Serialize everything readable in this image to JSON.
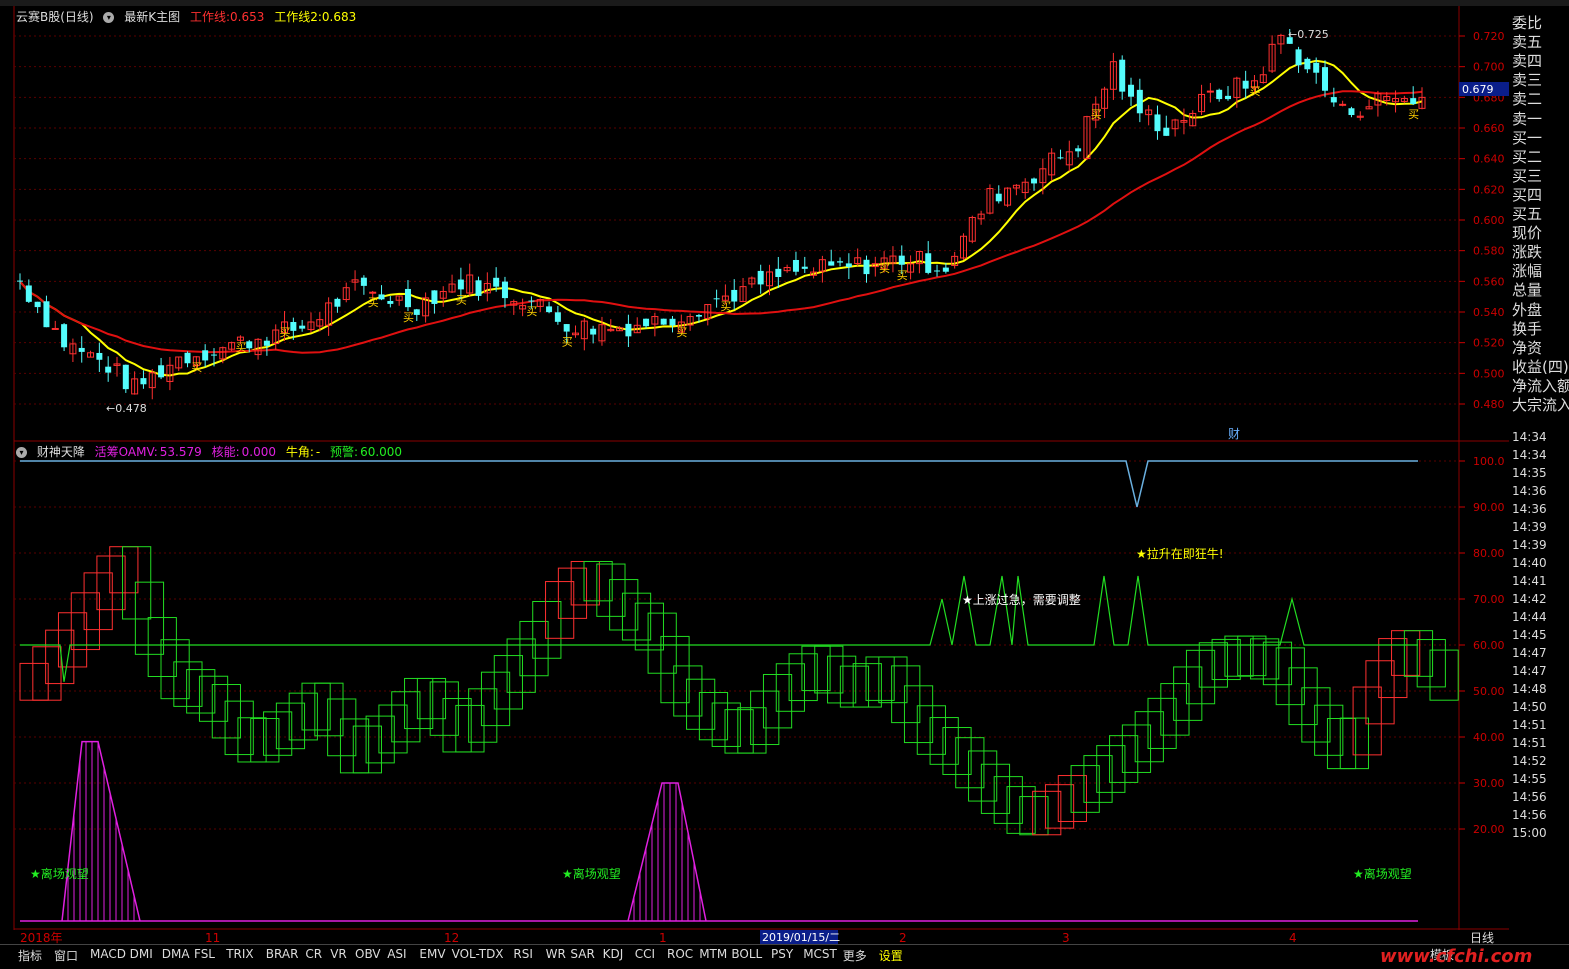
{
  "header": {
    "stock_name": "云赛B股(日线)",
    "main_chart_label": "最新K主图",
    "line1_label": "工作线:",
    "line1_value": "0.653",
    "line2_label": "工作线2:",
    "line2_value": "0.683"
  },
  "indicator": {
    "name": "财神天降",
    "oamv_label": "活筹OAMV:",
    "oamv_value": "53.579",
    "energy_label": "核能:",
    "energy_value": "0.000",
    "bull_label": "牛角:",
    "bull_value": "-",
    "warn_label": "预警:",
    "warn_value": "60.000"
  },
  "price_axis": [
    "0.720",
    "0.700",
    "0.680",
    "0.660",
    "0.640",
    "0.620",
    "0.600",
    "0.580",
    "0.560",
    "0.540",
    "0.520",
    "0.500",
    "0.480"
  ],
  "current_price": "0.679",
  "low_marker": "0.478",
  "high_marker": "0.725",
  "buy_marker": "买",
  "cai_marker": "财",
  "indicator_axis": [
    "100.0",
    "90.00",
    "80.00",
    "70.00",
    "60.00",
    "50.00",
    "40.00",
    "30.00",
    "20.00"
  ],
  "annotations": {
    "surge": "★拉升在即狂牛!",
    "too_fast": "★上涨过急，需要调整",
    "leave1": "★离场观望",
    "leave2": "★离场观望",
    "leave3": "★离场观望"
  },
  "x_axis": {
    "labels": [
      "2018年",
      "11",
      "12",
      "1",
      "2",
      "3",
      "4"
    ],
    "cursor_date": "2019/01/15/二",
    "period": "日线"
  },
  "right_panel": {
    "items": [
      "委比",
      "卖五",
      "卖四",
      "卖三",
      "卖二",
      "卖一",
      "买一",
      "买二",
      "买三",
      "买四",
      "买五",
      "现价",
      "涨跌",
      "涨幅",
      "总量",
      "外盘",
      "换手",
      "净资",
      "收益(四)",
      "净流入额",
      "大宗流入"
    ],
    "times": [
      "14:34",
      "14:34",
      "14:35",
      "14:36",
      "14:36",
      "14:39",
      "14:39",
      "14:40",
      "14:41",
      "14:42",
      "14:44",
      "14:45",
      "14:47",
      "14:47",
      "14:48",
      "14:50",
      "14:51",
      "14:51",
      "14:52",
      "14:55",
      "14:56",
      "14:56",
      "15:00"
    ]
  },
  "bottom_tabs": [
    "指标",
    "窗口",
    "MACD",
    "DMI",
    "DMA",
    "FSL",
    "TRIX",
    "BRAR",
    "CR",
    "VR",
    "OBV",
    "ASI",
    "EMV",
    "VOL-TDX",
    "RSI",
    "WR",
    "SAR",
    "KDJ",
    "CCI",
    "ROC",
    "MTM",
    "BOLL",
    "PSY",
    "MCST",
    "更多",
    "设置"
  ],
  "template_label": "模板",
  "logo": "www.cfchi.com",
  "colors": {
    "up": "#ff3030",
    "down": "#54fcfc",
    "ma_short": "#ffff00",
    "ma_long": "#e01010",
    "indicator_green": "#22dd22",
    "indicator_red": "#ff3030",
    "magenta": "#e020e0",
    "blue_line": "#6ab0e0"
  }
}
